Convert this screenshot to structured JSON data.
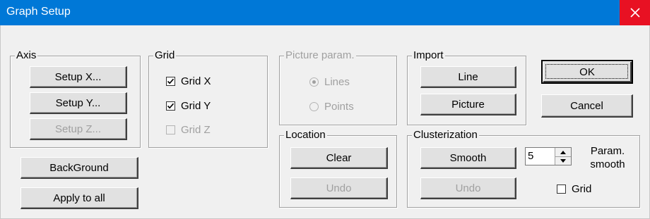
{
  "window": {
    "title": "Graph Setup",
    "close_icon": "close-x-icon",
    "accent_color": "#0078d7",
    "close_color": "#e81123"
  },
  "axis": {
    "label": "Axis",
    "setup_x": "Setup X...",
    "setup_y": "Setup Y...",
    "setup_z": "Setup Z..."
  },
  "grid": {
    "label": "Grid",
    "grid_x": "Grid X",
    "grid_x_checked": true,
    "grid_y": "Grid Y",
    "grid_y_checked": true,
    "grid_z": "Grid Z",
    "grid_z_checked": false
  },
  "picture_param": {
    "label": "Picture param.",
    "lines": "Lines",
    "lines_selected": true,
    "points": "Points"
  },
  "import": {
    "label": "Import",
    "line": "Line",
    "picture": "Picture"
  },
  "dialog_buttons": {
    "ok": "OK",
    "cancel": "Cancel"
  },
  "misc_buttons": {
    "background": "BackGround",
    "apply_to_all": "Apply to all"
  },
  "location": {
    "label": "Location",
    "clear": "Clear",
    "undo": "Undo"
  },
  "clusterization": {
    "label": "Clusterization",
    "smooth": "Smooth",
    "undo": "Undo",
    "param_value": "5",
    "param_label_1": "Param.",
    "param_label_2": "smooth",
    "grid": "Grid",
    "grid_checked": false
  }
}
